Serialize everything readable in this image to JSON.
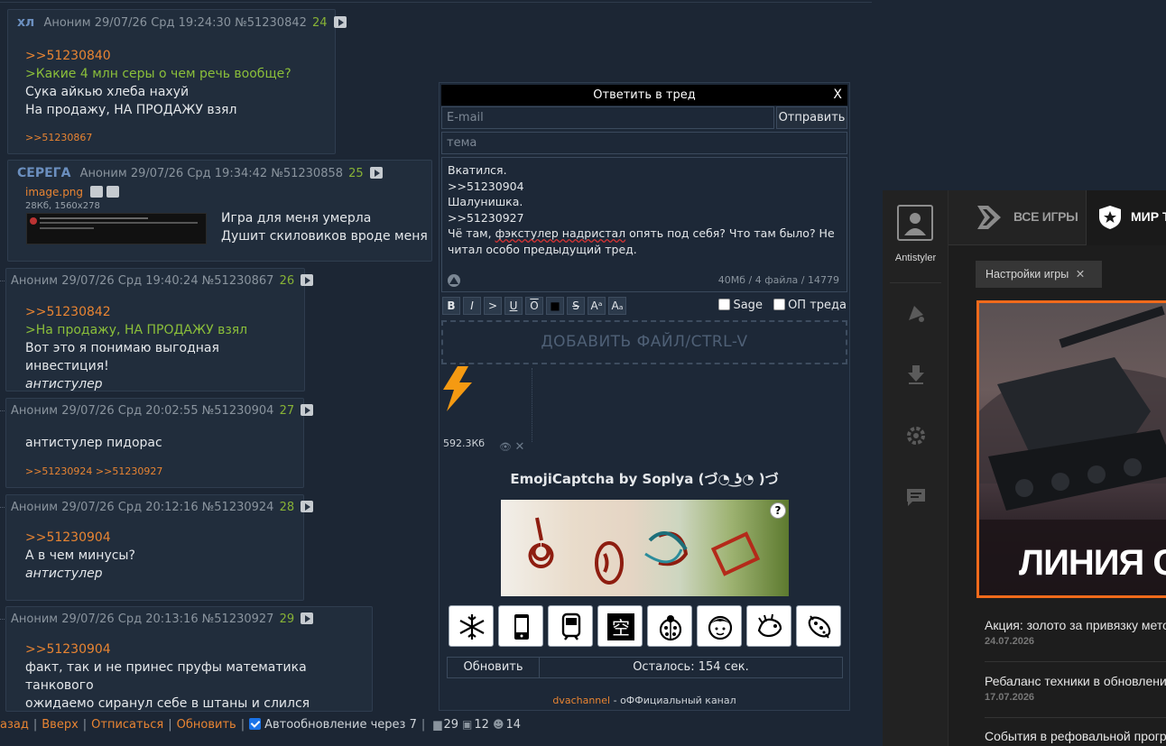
{
  "posts": [
    {
      "name": "хл",
      "anon": "Аноним",
      "date": "29/07/26 Срд 19:24:30",
      "num": "№51230842",
      "count": "24",
      "lines": [
        {
          "text": ">>51230840",
          "style": "reply"
        },
        {
          "text": ">Какие 4 млн серы о чем речь вообще?",
          "style": "quote"
        },
        {
          "text": "Сука айкью хлеба нахуй",
          "style": ""
        },
        {
          "text": "На продажу, НА ПРОДАЖУ взял",
          "style": ""
        }
      ],
      "replies": ">>51230867"
    },
    {
      "name": "СЕРЕГА",
      "anon": "Аноним",
      "date": "29/07/26 Срд 19:34:42",
      "num": "№51230858",
      "count": "25",
      "file": {
        "name": "image.png",
        "meta": "28Кб, 1560x278"
      },
      "lines": [
        {
          "text": "Игра для меня умерла",
          "style": ""
        },
        {
          "text": "Душит скиловиков вроде меня",
          "style": ""
        }
      ]
    },
    {
      "anon": "Аноним",
      "date": "29/07/26 Срд 19:40:24",
      "num": "№51230867",
      "count": "26",
      "lines": [
        {
          "text": ">>51230842",
          "style": "reply"
        },
        {
          "text": ">На продажу, НА ПРОДАЖУ взял",
          "style": "quote"
        },
        {
          "text": "Вот это я понимаю выгодная инвестиция!",
          "style": ""
        },
        {
          "text": "антистулер",
          "style": "em"
        }
      ]
    },
    {
      "anon": "Аноним",
      "date": "29/07/26 Срд 20:02:55",
      "num": "№51230904",
      "count": "27",
      "lines": [
        {
          "text": "антистулер пидорас",
          "style": ""
        }
      ],
      "replies": ">>51230924 >>51230927"
    },
    {
      "anon": "Аноним",
      "date": "29/07/26 Срд 20:12:16",
      "num": "№51230924",
      "count": "28",
      "lines": [
        {
          "text": ">>51230904",
          "style": "reply"
        },
        {
          "text": "А в чем минусы?",
          "style": ""
        },
        {
          "text": "антистулер",
          "style": "em"
        }
      ]
    },
    {
      "anon": "Аноним",
      "date": "29/07/26 Срд 20:13:16",
      "num": "№51230927",
      "count": "29",
      "lines": [
        {
          "text": ">>51230904",
          "style": "reply"
        },
        {
          "text": "факт, так и не принес пруфы математика танкового",
          "style": ""
        },
        {
          "text": "ожидаемо сиранул себе в штаны и слился",
          "style": ""
        }
      ]
    }
  ],
  "bottom_nav": {
    "back": "азад",
    "up": "Вверх",
    "unsubscribe": "Отписаться",
    "refresh": "Обновить",
    "autorefresh": "Автообновление через 7",
    "posts_count": "29",
    "images_count": "12",
    "users_count": "14"
  },
  "form": {
    "title": "Ответить в тред",
    "close": "X",
    "email_placeholder": "E-mail",
    "send": "Отправить",
    "subject_placeholder": "тема",
    "message_lines": [
      "Вкатился.",
      ">>51230904",
      "Шалунишка.",
      ">>51230927"
    ],
    "message_tail_a": "Чё там, ",
    "message_tail_b": "фэкстулер надристал",
    "message_tail_c": " опять под себя? Что там было? Не читал особо предыдущий тред.",
    "limits": "40Мб / 4 файла / 14779",
    "toolbar": [
      "B",
      "I",
      ">",
      "U",
      "O",
      "■",
      "S",
      "Aᵃ",
      "Aₐ"
    ],
    "sage": "Sage",
    "op": "ОП треда",
    "dropzone": "ДОБАВИТЬ ФАЙЛ/CTRL-V",
    "file_size": "592.3Кб",
    "captcha_title": "EmojiCaptcha by Soplya (づ◔ ͜ʖ◔ )づ",
    "captcha_help": "?",
    "emoji_icons": [
      "snowflake-icon",
      "phone-icon",
      "train-icon",
      "kanji-sky-icon",
      "ladybug-icon",
      "face-icon",
      "dragon-icon",
      "microbe-icon"
    ],
    "refresh": "Обновить",
    "timer": "Осталось: 154 сек.",
    "footer_channel": "dvachannel",
    "footer_text": " - оФФициальный канал"
  },
  "game": {
    "username": "Antistyler",
    "tab_all": "ВСЕ ИГРЫ",
    "tab_wot": "МИР Т",
    "settings": "Настройки игры",
    "banner_title": "ЛИНИЯ С",
    "news": [
      {
        "title": "Акция: золото за привязку метод",
        "date": "24.07.2026"
      },
      {
        "title": "Ребаланс техники в обновлении",
        "date": "17.07.2026"
      },
      {
        "title": "События в рефовальной програм",
        "date": ""
      }
    ],
    "accent": "#f26a1b"
  },
  "colors": {
    "reply": "#e88432",
    "quote": "#8bbf3a",
    "background": "#1c2634",
    "post_bg": "#212d3c"
  }
}
